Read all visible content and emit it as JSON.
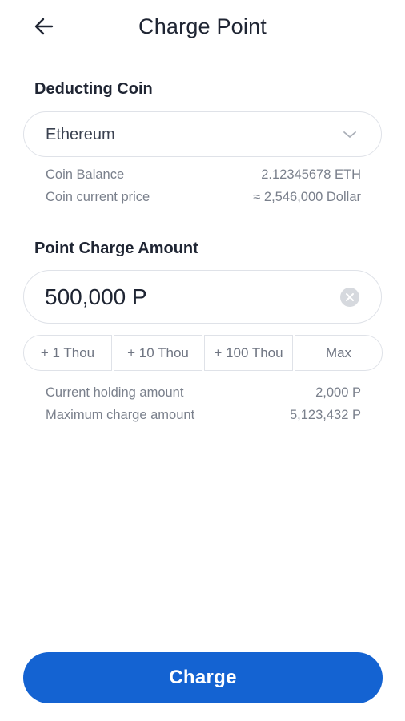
{
  "header": {
    "title": "Charge Point",
    "back_icon": "arrow-left-icon"
  },
  "deducting_coin": {
    "label": "Deducting Coin",
    "selected": "Ethereum",
    "chevron_icon": "chevron-down-icon",
    "info": [
      {
        "label": "Coin Balance",
        "value": "2.12345678 ETH"
      },
      {
        "label": "Coin current price",
        "value": "≈ 2,546,000 Dollar"
      }
    ]
  },
  "point_charge": {
    "label": "Point Charge Amount",
    "amount_value": "500,000 P",
    "clear_icon": "clear-circle-icon",
    "quick_buttons": [
      "+ 1 Thou",
      "+ 10 Thou",
      "+ 100 Thou",
      "Max"
    ],
    "info": [
      {
        "label": "Current holding amount",
        "value": "2,000 P"
      },
      {
        "label": "Maximum charge amount",
        "value": "5,123,432 P"
      }
    ]
  },
  "charge_button": {
    "label": "Charge"
  },
  "colors": {
    "primary": "#1463d2",
    "text": "#1f2533",
    "muted": "#7a808c",
    "border": "#dfe2e8"
  }
}
